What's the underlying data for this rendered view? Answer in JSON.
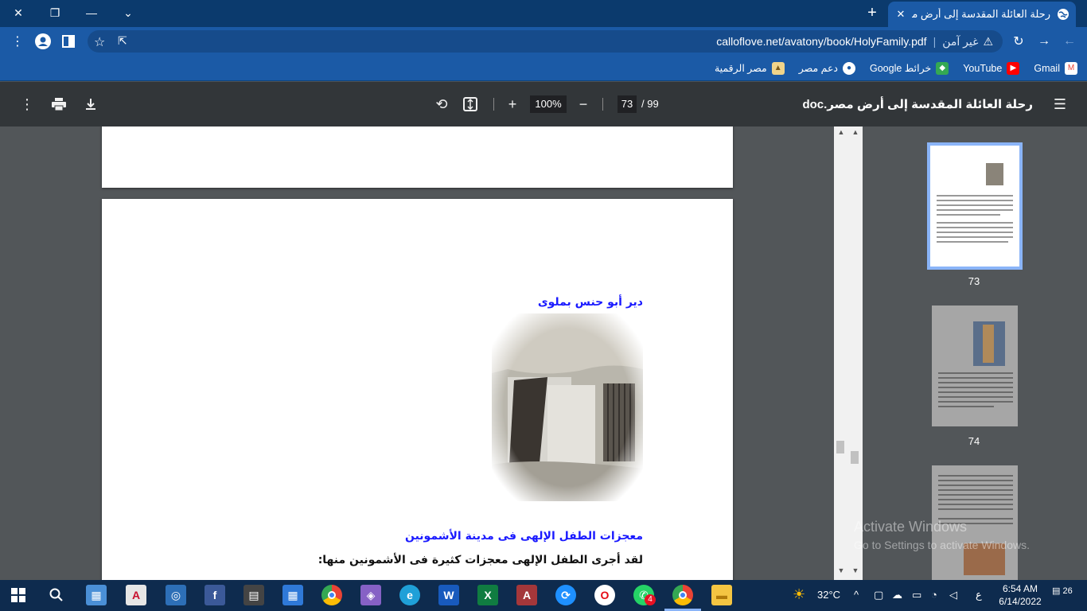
{
  "browser": {
    "tab_title": "رحلة العائلة المقدسة إلى أرض مصر",
    "tab_close": "✕",
    "new_tab": "+",
    "window_controls": {
      "minimize": "—",
      "restore": "❐",
      "close": "✕",
      "tabsearch": "⌄"
    },
    "address": {
      "security_label": "غير آمن",
      "url": "calloflove.net/avatony/book/HolyFamily.pdf"
    },
    "bookmarks": [
      {
        "label": "Gmail",
        "icon": "gmail-icon",
        "color": "#ea4335"
      },
      {
        "label": "YouTube",
        "icon": "youtube-icon",
        "color": "#ff0000"
      },
      {
        "label": "خرائط Google",
        "icon": "maps-icon",
        "color": "#34a853"
      },
      {
        "label": "دعم مصر",
        "icon": "globe-icon",
        "color": "#ffffff"
      },
      {
        "label": "مصر الرقمية",
        "icon": "digital-egypt-icon",
        "color": "#f0d48a"
      }
    ]
  },
  "pdf_toolbar": {
    "title": "رحلة العائلة المقدسة إلى أرض مصر.doc",
    "current_page": "73",
    "total_pages": "/ 99",
    "zoom": "100%"
  },
  "document": {
    "heading1": "دير أبو حنس بملوى",
    "heading2": "معجزات الطفل الإلهى فى مدينة الأشمونين",
    "paragraph1": "لقد أجرى الطفل الإلهى معجزات كثيرة فى الأشمونين منها:"
  },
  "thumbnails": [
    {
      "page": "73",
      "selected": true
    },
    {
      "page": "74",
      "selected": false
    }
  ],
  "watermark": {
    "line1": "Activate Windows",
    "line2": "Go to Settings to activate Windows."
  },
  "taskbar": {
    "weather": "32°C",
    "time": "6:54 AM",
    "date": "6/14/2022",
    "lang": "ع",
    "notifications": "26",
    "whatsapp_badge": "4"
  },
  "colors": {
    "tabbar": "#0b3a6d",
    "toolbar": "#1b5aa6",
    "pdf_toolbar": "#323639",
    "doc_bg": "#525659",
    "heading": "#1a1aff",
    "taskbar": "#0e2b4e"
  }
}
